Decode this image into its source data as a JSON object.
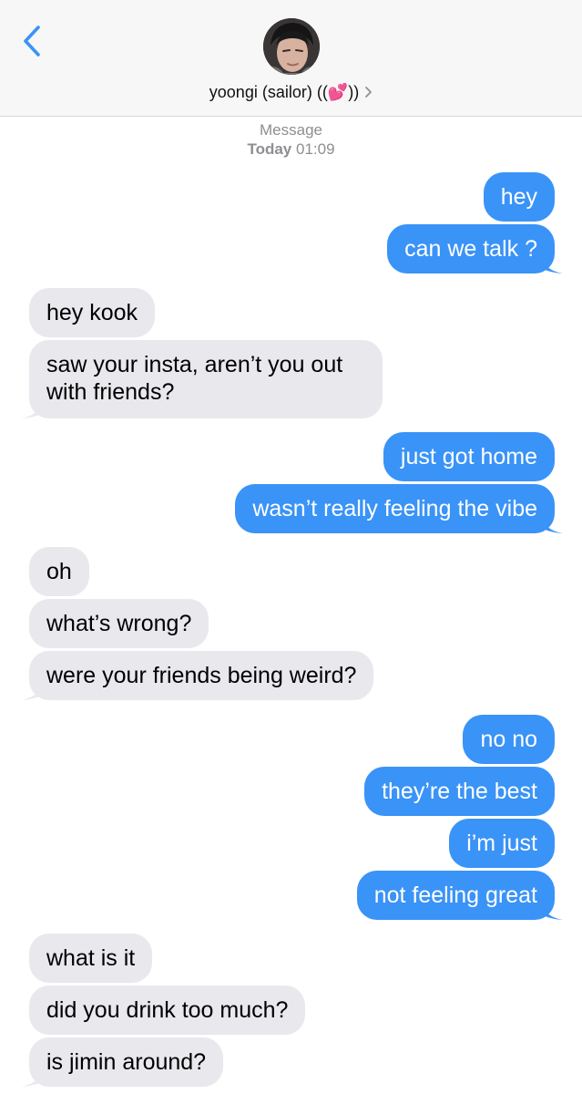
{
  "header": {
    "contact_name": "yoongi (sailor) ((💕))",
    "accent_color": "#3a93f7"
  },
  "meta": {
    "service": "Message",
    "day": "Today",
    "time": "01:09"
  },
  "messages": [
    {
      "dir": "out",
      "text": "hey"
    },
    {
      "dir": "out",
      "text": "can we talk ?"
    },
    {
      "dir": "in",
      "text": "hey kook"
    },
    {
      "dir": "in",
      "text": "saw your insta, aren’t you out with friends?"
    },
    {
      "dir": "out",
      "text": "just got home"
    },
    {
      "dir": "out",
      "text": "wasn’t really feeling the vibe"
    },
    {
      "dir": "in",
      "text": "oh"
    },
    {
      "dir": "in",
      "text": "what’s wrong?"
    },
    {
      "dir": "in",
      "text": "were your friends being weird?"
    },
    {
      "dir": "out",
      "text": "no no"
    },
    {
      "dir": "out",
      "text": "they’re the best"
    },
    {
      "dir": "out",
      "text": "i’m just"
    },
    {
      "dir": "out",
      "text": "not feeling great"
    },
    {
      "dir": "in",
      "text": "what is it"
    },
    {
      "dir": "in",
      "text": "did you drink too much?"
    },
    {
      "dir": "in",
      "text": "is jimin around?"
    }
  ]
}
